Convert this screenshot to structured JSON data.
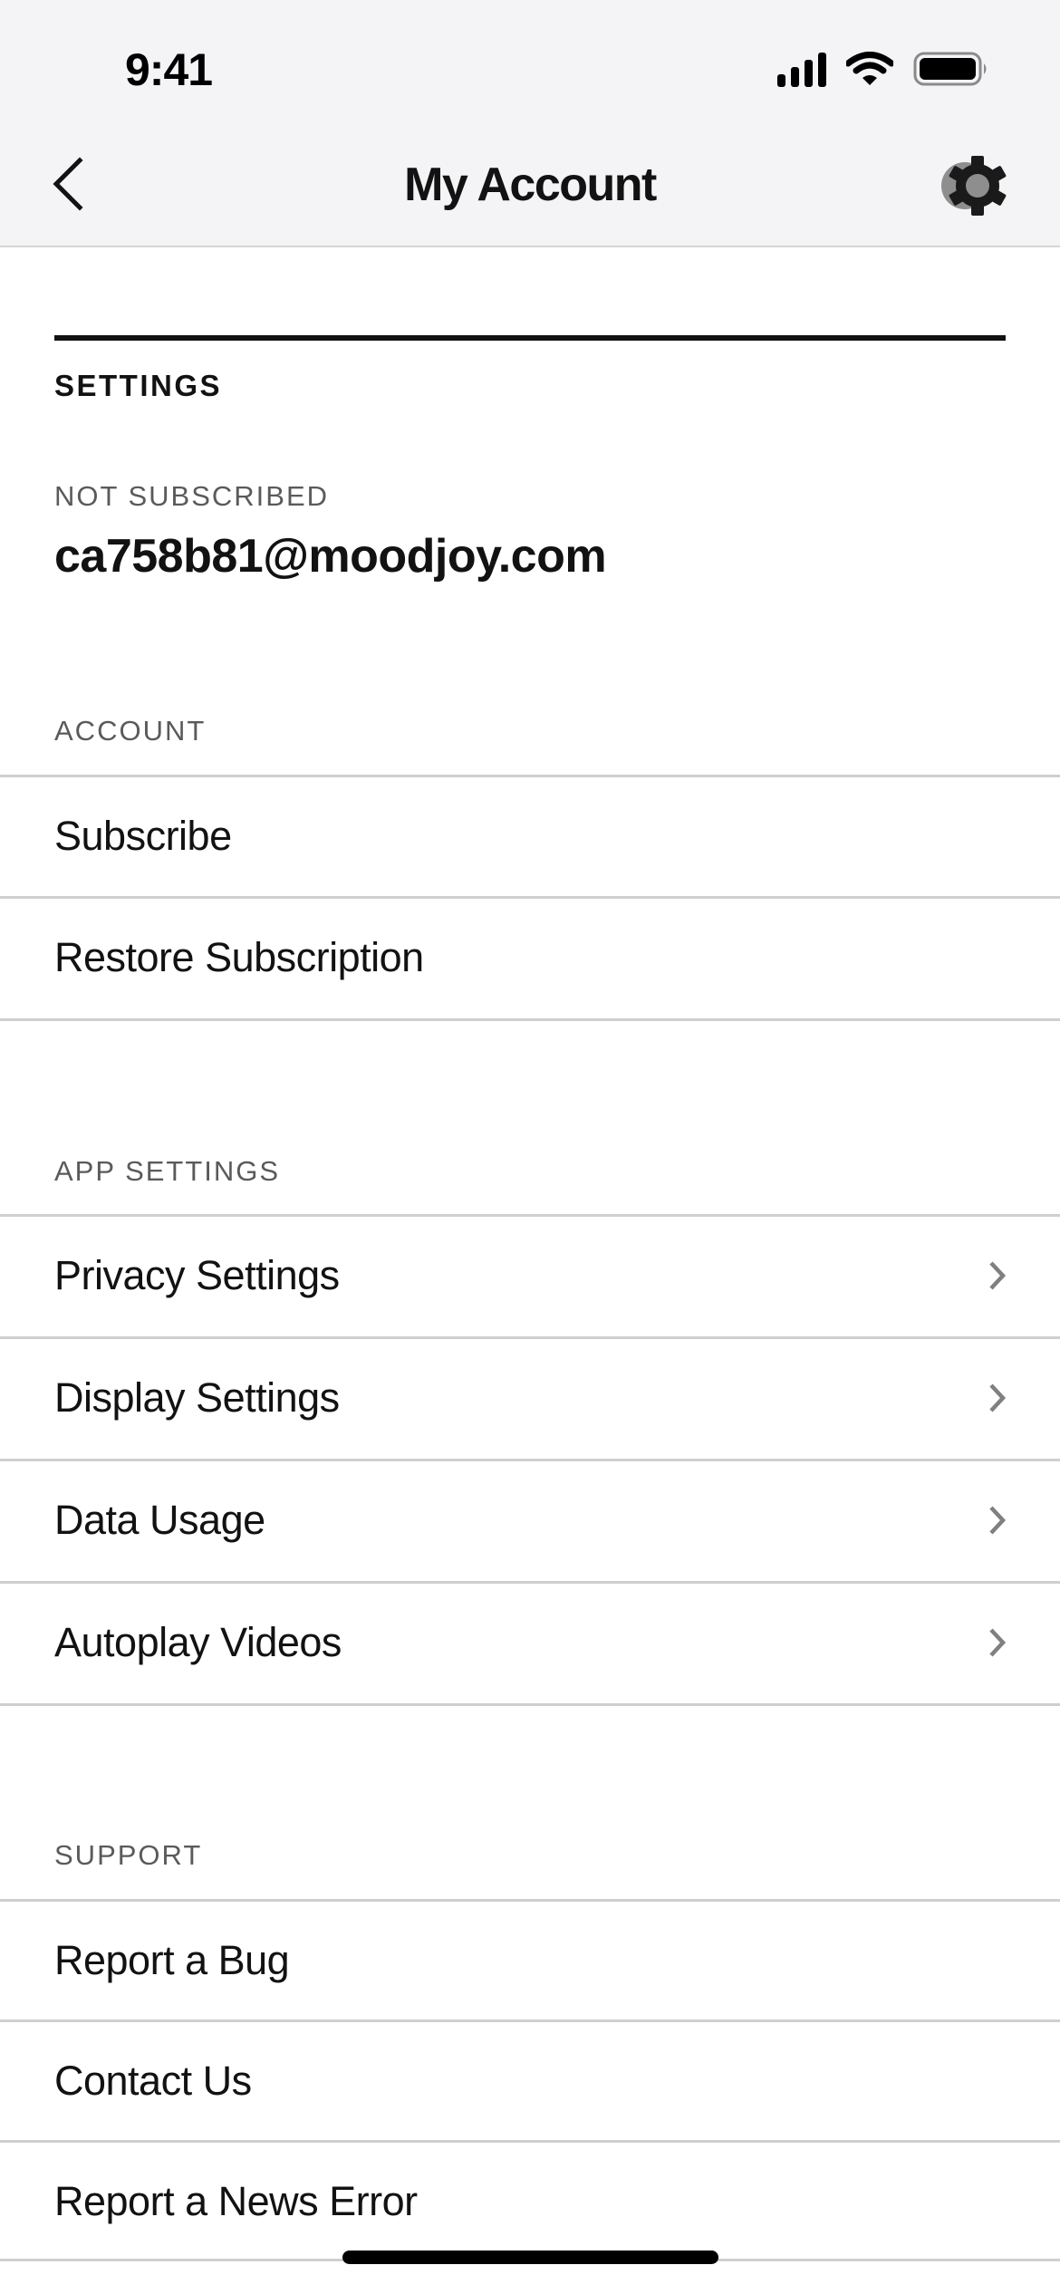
{
  "status_bar": {
    "time": "9:41",
    "icons": [
      "cellular-signal-icon",
      "wifi-icon",
      "battery-icon"
    ]
  },
  "nav": {
    "back_icon": "chevron-left-icon",
    "title": "My Account",
    "settings_icon": "gear-icon"
  },
  "settings": {
    "heading": "SETTINGS",
    "subscription_status": "NOT SUBSCRIBED",
    "email": "ca758b81@moodjoy.com"
  },
  "sections": {
    "account": {
      "header": "ACCOUNT",
      "items": [
        {
          "label": "Subscribe",
          "has_chevron": false
        },
        {
          "label": "Restore Subscription",
          "has_chevron": false
        }
      ]
    },
    "app_settings": {
      "header": "APP SETTINGS",
      "items": [
        {
          "label": "Privacy Settings",
          "has_chevron": true
        },
        {
          "label": "Display Settings",
          "has_chevron": true
        },
        {
          "label": "Data Usage",
          "has_chevron": true
        },
        {
          "label": "Autoplay Videos",
          "has_chevron": true
        }
      ]
    },
    "support": {
      "header": "SUPPORT",
      "items": [
        {
          "label": "Report a Bug",
          "has_chevron": false
        },
        {
          "label": "Contact Us",
          "has_chevron": false
        },
        {
          "label": "Report a News Error",
          "has_chevron": false
        }
      ]
    }
  },
  "colors": {
    "text_primary": "#121212",
    "text_secondary": "#5a5a5a",
    "divider": "#cfcfcf",
    "chevron": "#808080",
    "header_bg": "#f4f3f5"
  }
}
